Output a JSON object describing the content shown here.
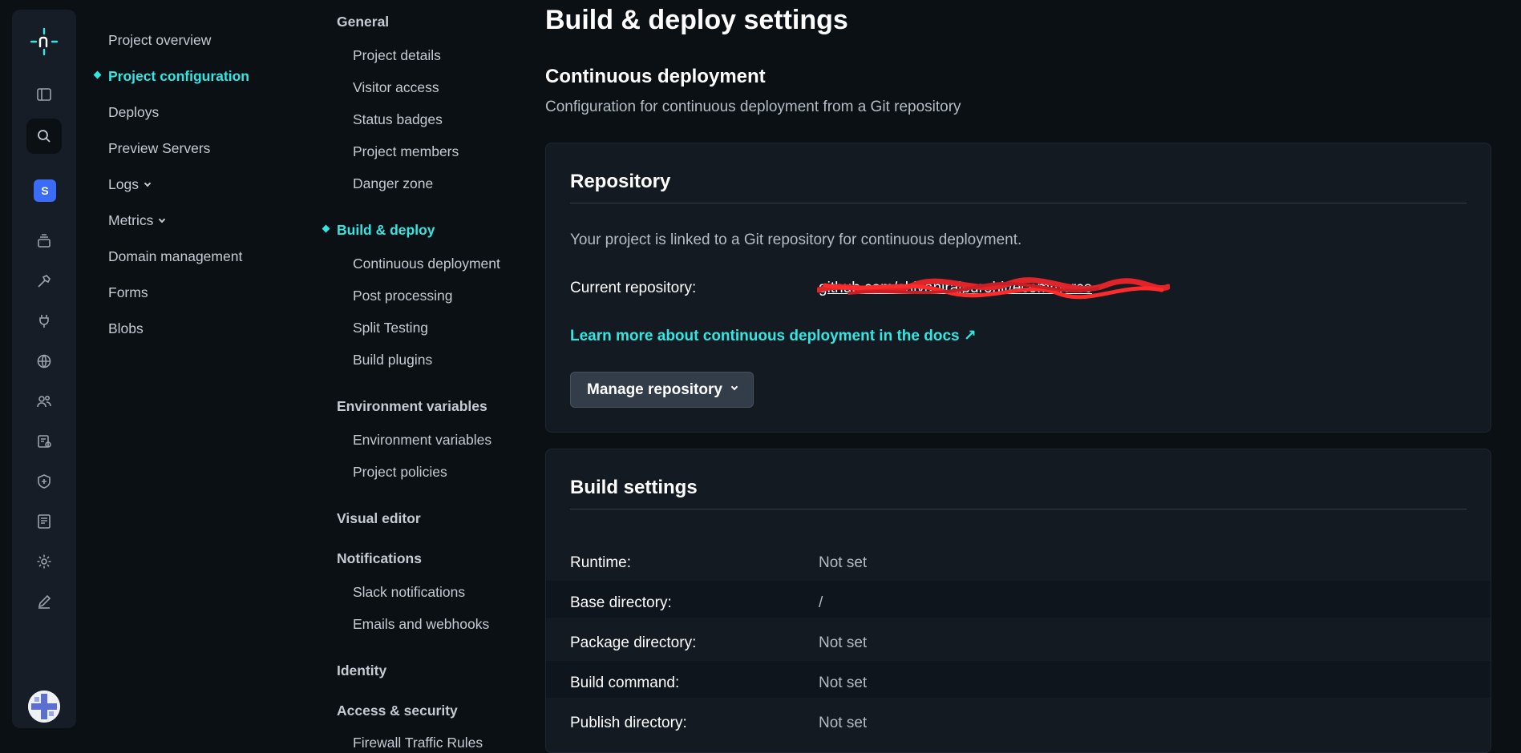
{
  "rail": {
    "badge": "S"
  },
  "nav_primary": {
    "items": [
      {
        "label": "Project overview",
        "active": false
      },
      {
        "label": "Project configuration",
        "active": true
      },
      {
        "label": "Deploys",
        "active": false
      },
      {
        "label": "Preview Servers",
        "active": false
      },
      {
        "label": "Logs",
        "active": false,
        "expandable": true
      },
      {
        "label": "Metrics",
        "active": false,
        "expandable": true
      },
      {
        "label": "Domain management",
        "active": false
      },
      {
        "label": "Forms",
        "active": false
      },
      {
        "label": "Blobs",
        "active": false
      }
    ]
  },
  "nav_secondary": {
    "general": {
      "label": "General",
      "items": [
        "Project details",
        "Visitor access",
        "Status badges",
        "Project members",
        "Danger zone"
      ]
    },
    "build_deploy": {
      "label": "Build & deploy",
      "items": [
        "Continuous deployment",
        "Post processing",
        "Split Testing",
        "Build plugins"
      ]
    },
    "env": {
      "label": "Environment variables",
      "items": [
        "Environment variables",
        "Project policies"
      ]
    },
    "visual_editor": {
      "label": "Visual editor"
    },
    "notifications": {
      "label": "Notifications",
      "items": [
        "Slack notifications",
        "Emails and webhooks"
      ]
    },
    "identity": {
      "label": "Identity"
    },
    "access": {
      "label": "Access & security",
      "items": [
        "Firewall Traffic Rules"
      ]
    }
  },
  "main": {
    "page_title": "Build & deploy settings",
    "section_title": "Continuous deployment",
    "section_desc": "Configuration for continuous deployment from a Git repository",
    "repo_card": {
      "title": "Repository",
      "linked_text": "Your project is linked to a Git repository for continuous deployment.",
      "current_repo_label": "Current repository:",
      "current_repo_value": "github.com/shivanirajpurohit/ecommerce",
      "learn_more": "Learn more about continuous deployment in the docs ↗",
      "manage_button": "Manage repository"
    },
    "build_card": {
      "title": "Build settings",
      "rows": [
        {
          "label": "Runtime:",
          "value": "Not set"
        },
        {
          "label": "Base directory:",
          "value": "/"
        },
        {
          "label": "Package directory:",
          "value": "Not set"
        },
        {
          "label": "Build command:",
          "value": "Not set"
        },
        {
          "label": "Publish directory:",
          "value": "Not set"
        }
      ]
    }
  }
}
